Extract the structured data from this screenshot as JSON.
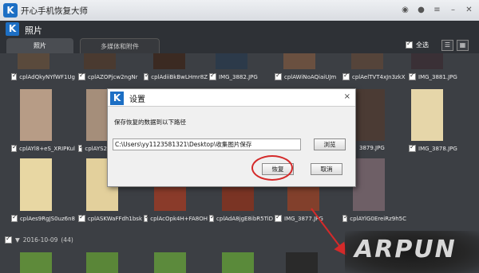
{
  "app": {
    "title": "开心手机恢复大师",
    "logo_letter": "K"
  },
  "section": {
    "title": "照片",
    "logo_letter": "K"
  },
  "tabs": [
    {
      "label": "照片"
    },
    {
      "label": "多媒体和附件"
    }
  ],
  "toolbar": {
    "select_all_label": "全选"
  },
  "thumbs": {
    "row1": [
      "cplAdQkyNYfWF1Ug",
      "cplAZOPjcw2ngNr",
      "cplAdiiBkBwLHmr8Z",
      "IMG_3882.JPG",
      "cplAWiNoAQiaiUJm",
      "cplAelTVT4xJn3zkX",
      "IMG_3881.JPG"
    ],
    "row2": [
      "cplAYl8+eS_XRIPKul",
      "cplAYS2",
      "3879.JPG",
      "IMG_3878.JPG"
    ],
    "row3": [
      "cplAes9RgJS0uz6n8",
      "cplASKWaFFdh1bsk",
      "cplAcOpk4H+FA8OH",
      "cplAdA8jgE8ibR5TiD",
      "IMG_3877.JPG",
      "cplAYlG0EreiRz9h5C"
    ]
  },
  "date_group": {
    "label": "2016-10-09",
    "count": "(44)"
  },
  "dialog": {
    "logo_letter": "K",
    "title": "设置",
    "message": "保存恢复的数据到以下路径",
    "path": "C:\\Users\\yy1123581321\\Desktop\\收集图片保存",
    "browse_label": "浏览",
    "restore_label": "恢复",
    "cancel_label": "取消",
    "close_icon": "×"
  },
  "watermark": {
    "text": "ARPUN"
  },
  "colors": {
    "accent": "#1d6fc4",
    "highlight": "#d42a2a"
  }
}
